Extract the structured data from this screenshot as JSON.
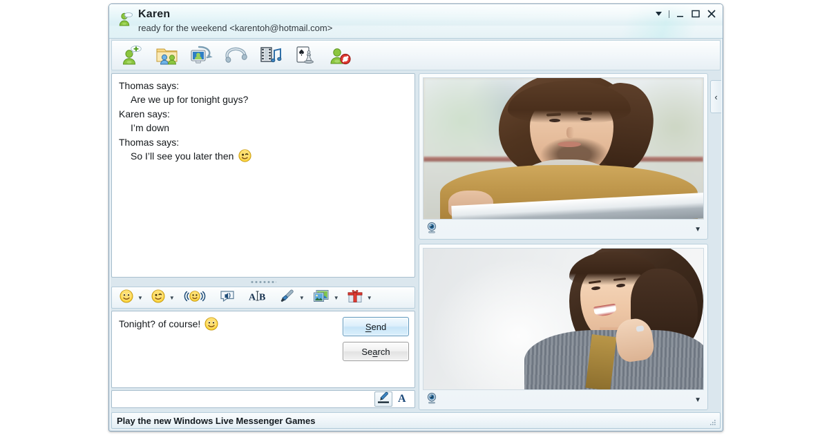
{
  "window": {
    "contact_name": "Karen",
    "status_line": "ready for the weekend <karentoh@hotmail.com>",
    "avatar_icon": "contact-avatar-icon",
    "controls": [
      {
        "name": "menu-dropdown-button",
        "icon": "chevron-down-icon",
        "glyph": "▼"
      },
      {
        "name": "window-separator",
        "icon": "separator-icon",
        "glyph": ""
      },
      {
        "name": "minimize-button",
        "icon": "minimize-icon",
        "glyph": "–"
      },
      {
        "name": "maximize-button",
        "icon": "maximize-icon",
        "glyph": "☐"
      },
      {
        "name": "close-button",
        "icon": "close-icon",
        "glyph": "✕"
      }
    ]
  },
  "toolbar": {
    "buttons": [
      {
        "name": "invite-contact-button",
        "icon": "person-add-icon",
        "label": "Invite"
      },
      {
        "name": "send-files-button",
        "icon": "shared-folder-icon",
        "label": "Files"
      },
      {
        "name": "video-call-button",
        "icon": "video-call-icon",
        "label": "Video"
      },
      {
        "name": "voice-call-button",
        "icon": "phone-call-icon",
        "label": "Call"
      },
      {
        "name": "activities-button",
        "icon": "film-music-icon",
        "label": "Activities"
      },
      {
        "name": "games-button",
        "icon": "cards-chess-icon",
        "label": "Games"
      },
      {
        "name": "block-contact-button",
        "icon": "person-block-icon",
        "label": "Block"
      }
    ]
  },
  "chat": {
    "messages": [
      {
        "sender": "Thomas says:",
        "text": "Are we up for tonight guys?",
        "emoticon": ""
      },
      {
        "sender": "Karen says:",
        "text": "I’m down",
        "emoticon": ""
      },
      {
        "sender": "Thomas says:",
        "text": "So I’ll see you later then",
        "emoticon": "wink-smiley-icon"
      }
    ]
  },
  "format_bar": {
    "buttons": [
      {
        "name": "emoticon-button",
        "icon": "smiley-icon",
        "caret": true
      },
      {
        "name": "wink-button",
        "icon": "wink-smiley-icon",
        "caret": true
      },
      {
        "name": "nudge-button",
        "icon": "nudge-icon",
        "caret": false
      },
      {
        "name": "sound-button",
        "icon": "speaker-icon",
        "caret": false
      },
      {
        "name": "font-button",
        "icon": "font-ab-icon",
        "caret": false
      },
      {
        "name": "background-button",
        "icon": "paintbrush-icon",
        "caret": true
      },
      {
        "name": "display-picture-button",
        "icon": "photo-icon",
        "caret": true
      },
      {
        "name": "gift-button",
        "icon": "gift-icon",
        "caret": true
      }
    ]
  },
  "compose": {
    "text": "Tonight? of course!",
    "emoticon": "smiley-icon",
    "placeholder": "",
    "send_label": "Send",
    "send_access_key": "S",
    "search_label": "Search",
    "search_access_key": "a"
  },
  "ink_bar": {
    "buttons": [
      {
        "name": "handwriting-button",
        "icon": "pen-icon",
        "selected": true
      },
      {
        "name": "text-mode-button",
        "icon": "letter-a-icon",
        "selected": false
      }
    ]
  },
  "video_panels": [
    {
      "name": "remote-video-panel",
      "webcam_icon": "webcam-icon",
      "menu_icon": "chevron-down-icon",
      "menu_glyph": "▼",
      "subject": "man at laptop"
    },
    {
      "name": "local-video-panel",
      "webcam_icon": "webcam-icon",
      "menu_icon": "chevron-down-icon",
      "menu_glyph": "▼",
      "subject": "smiling woman"
    }
  ],
  "side_panel": {
    "collapse_icon": "chevron-left-icon",
    "collapse_glyph": "‹"
  },
  "statusbar": {
    "text": "Play the new Windows Live Messenger Games",
    "resize_grip_icon": "resize-grip-icon"
  },
  "colors": {
    "frame": "#dbe7ee",
    "frame_border": "#8ba6bb",
    "accent_blue": "#1f5c8b",
    "send_border": "#5d97bd",
    "messenger_green": "#7cb842"
  }
}
